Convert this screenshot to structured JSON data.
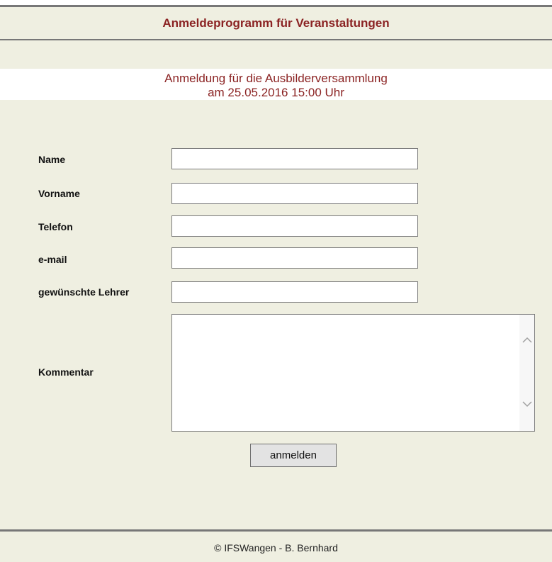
{
  "header": {
    "title": "Anmeldeprogramm für Veranstaltungen"
  },
  "event": {
    "line1": "Anmeldung für die Ausbilderversammlung",
    "line2": "am 25.05.2016 15:00 Uhr"
  },
  "form": {
    "name_label": "Name",
    "name_value": "",
    "vorname_label": "Vorname",
    "vorname_value": "",
    "telefon_label": "Telefon",
    "telefon_value": "",
    "email_label": "e-mail",
    "email_value": "",
    "lehrer_label": "gewünschte Lehrer",
    "lehrer_value": "",
    "kommentar_label": "Kommentar",
    "kommentar_value": "",
    "submit_label": "anmelden"
  },
  "icons": {
    "scroll_up": "chevron-up-icon",
    "scroll_down": "chevron-down-icon"
  },
  "footer": {
    "text": "© IFSWangen - B. Bernhard"
  },
  "colors": {
    "accent": "#8b2323",
    "background": "#efefe1",
    "rule": "#777777"
  }
}
